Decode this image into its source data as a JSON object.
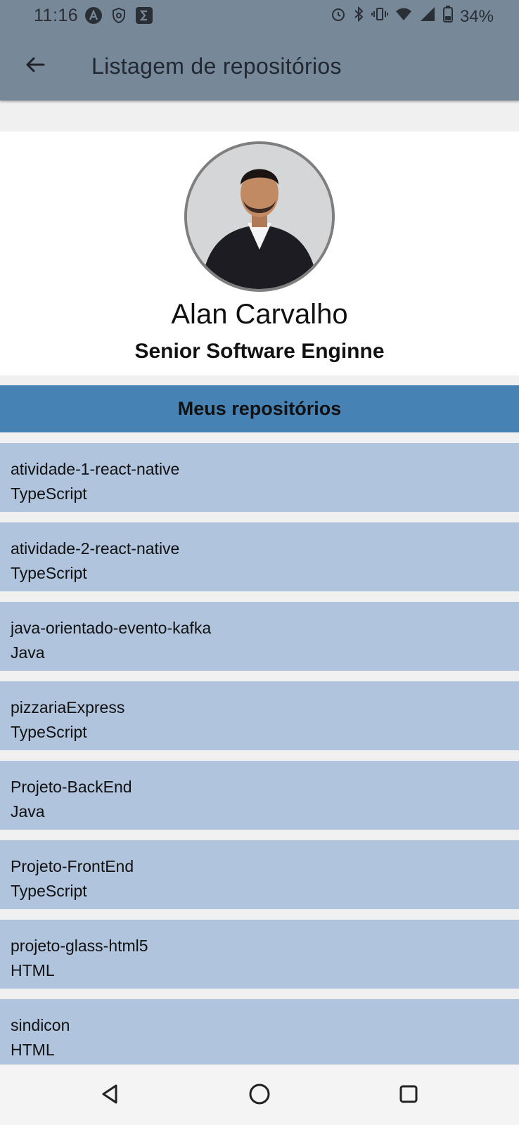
{
  "status_bar": {
    "time": "11:16",
    "battery": "34%"
  },
  "app_bar": {
    "title": "Listagem de repositórios",
    "background": "#778899"
  },
  "profile": {
    "name": "Alan Carvalho",
    "role": "Senior Software Enginne"
  },
  "repositories_section": {
    "title": "Meus repositórios",
    "header_color": "#4682b4",
    "item_color": "#b0c4de",
    "items": [
      {
        "name": "atividade-1-react-native",
        "language": "TypeScript"
      },
      {
        "name": "atividade-2-react-native",
        "language": "TypeScript"
      },
      {
        "name": "java-orientado-evento-kafka",
        "language": "Java"
      },
      {
        "name": "pizzariaExpress",
        "language": "TypeScript"
      },
      {
        "name": "Projeto-BackEnd",
        "language": "Java"
      },
      {
        "name": "Projeto-FrontEnd",
        "language": "TypeScript"
      },
      {
        "name": "projeto-glass-html5",
        "language": "HTML"
      },
      {
        "name": "sindicon",
        "language": "HTML"
      }
    ]
  },
  "icons": {
    "back": "arrow-left-icon",
    "nav_back": "triangle-back-icon",
    "nav_home": "circle-home-icon",
    "nav_recents": "square-recents-icon"
  }
}
